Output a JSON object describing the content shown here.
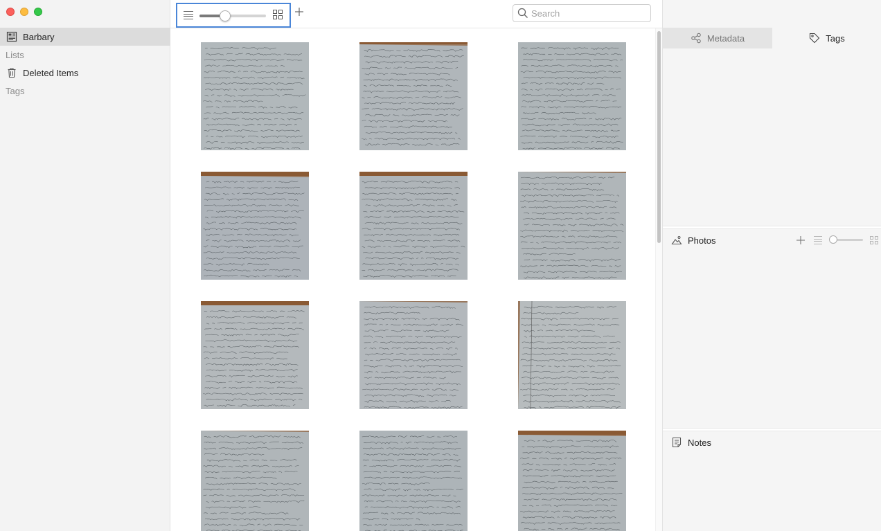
{
  "window": {
    "controls": [
      "close",
      "minimize",
      "maximize"
    ]
  },
  "sidebar": {
    "library": {
      "label": "Barbary",
      "icon": "library-icon",
      "selected": true
    },
    "lists_header": "Lists",
    "lists": [
      {
        "label": "Deleted Items",
        "icon": "trash-icon"
      }
    ],
    "tags_header": "Tags"
  },
  "toolbar": {
    "view_list_icon": "list-view-icon",
    "thumbnail_size_slider_fraction": 0.36,
    "view_grid_icon": "grid-view-icon",
    "add_icon": "plus-icon",
    "search_placeholder": "Search",
    "search_value": ""
  },
  "grid": {
    "items": [
      {
        "kind": "manuscript-page",
        "tone": "blue-gray",
        "paper": "#aab0b3"
      },
      {
        "kind": "manuscript-page",
        "tone": "blue-gray",
        "paper": "#a9aeb2"
      },
      {
        "kind": "manuscript-page",
        "tone": "blue-gray",
        "paper": "#a6acaf"
      },
      {
        "kind": "manuscript-page",
        "tone": "blue-gray",
        "paper": "#a4aab0"
      },
      {
        "kind": "manuscript-page",
        "tone": "blue-gray",
        "paper": "#a7adb1"
      },
      {
        "kind": "manuscript-page",
        "tone": "blue-gray",
        "paper": "#a9aeb0"
      },
      {
        "kind": "manuscript-page",
        "tone": "blue-gray",
        "paper": "#aeb2b4"
      },
      {
        "kind": "manuscript-page",
        "tone": "blue-gray",
        "paper": "#acb1b4"
      },
      {
        "kind": "manuscript-page",
        "tone": "blue-gray",
        "paper": "#b2b6b7"
      },
      {
        "kind": "manuscript-page",
        "tone": "blue-gray",
        "paper": "#a9aeb1"
      },
      {
        "kind": "manuscript-page",
        "tone": "blue-gray",
        "paper": "#a5abaf"
      },
      {
        "kind": "manuscript-page",
        "tone": "blue-gray",
        "paper": "#a6abae"
      }
    ]
  },
  "inspector": {
    "tabs": [
      {
        "label": "Metadata",
        "icon": "share-nodes-icon",
        "active": true
      },
      {
        "label": "Tags",
        "icon": "tag-icon",
        "active": false
      }
    ],
    "photos": {
      "title": "Photos",
      "icon": "photo-landscape-icon",
      "thumb_size_fraction": 0.0
    },
    "notes": {
      "title": "Notes",
      "icon": "note-icon"
    }
  },
  "colors": {
    "selection_outline": "#4a86d8",
    "sidebar_bg": "#f3f3f3",
    "sidebar_selected": "#dcdcdc",
    "wood": "#8a5a34"
  }
}
